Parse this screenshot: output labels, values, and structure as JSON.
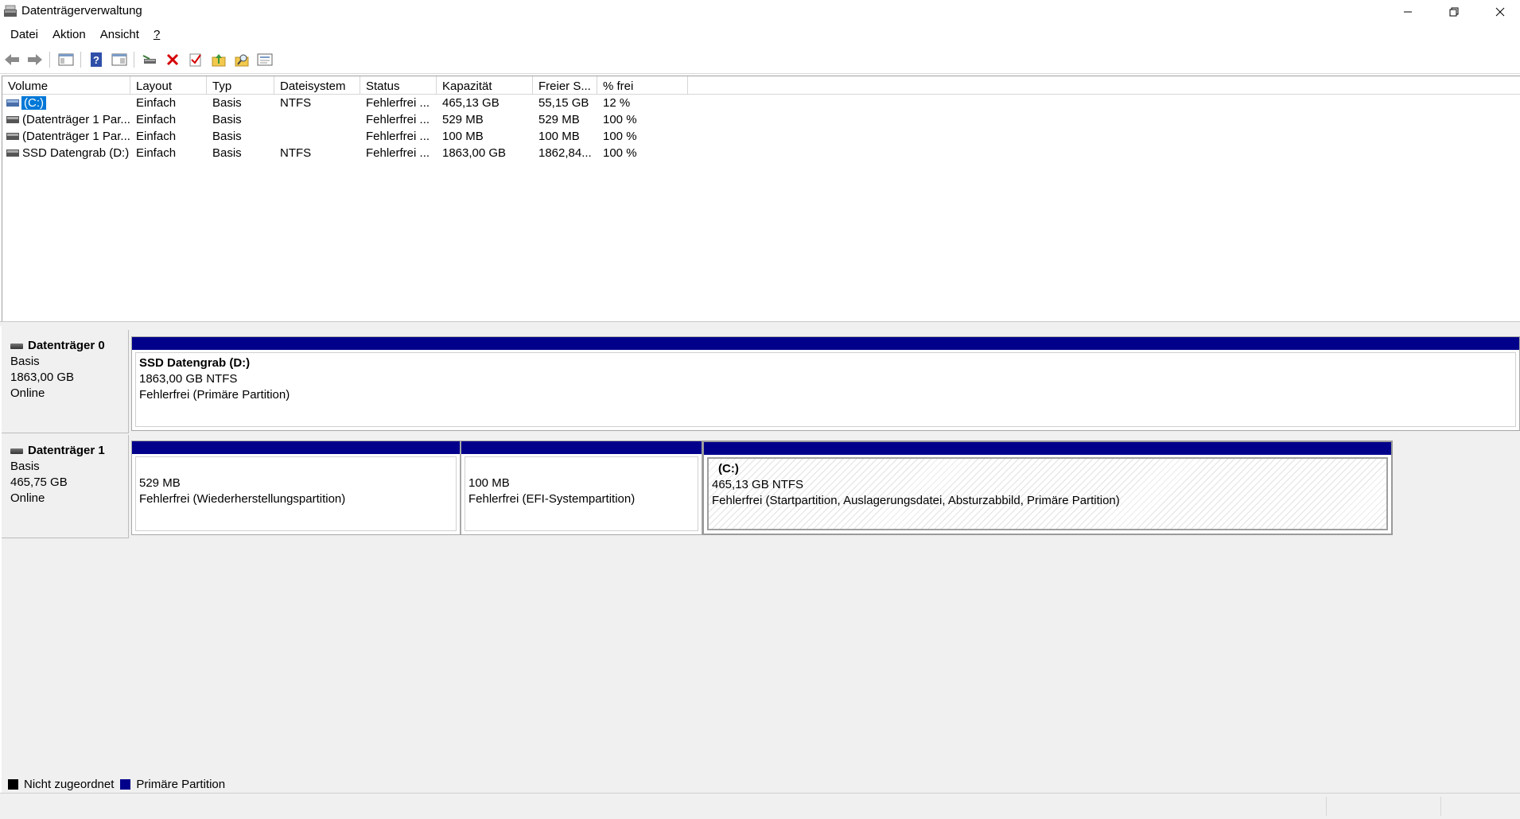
{
  "window": {
    "title": "Datenträgerverwaltung"
  },
  "menu": [
    "Datei",
    "Aktion",
    "Ansicht",
    "?"
  ],
  "toolbar": {
    "icons": [
      "back-icon",
      "forward-icon",
      "console-tree-icon",
      "help-icon",
      "properties-icon",
      "connect-icon",
      "delete-icon",
      "check-icon",
      "up-folder-icon",
      "search-folder-icon",
      "settings-list-icon"
    ],
    "accent_delete": "#d40000"
  },
  "columns": [
    "Volume",
    "Layout",
    "Typ",
    "Dateisystem",
    "Status",
    "Kapazität",
    "Freier S...",
    "% frei"
  ],
  "volumes": [
    {
      "volume": "(C:)",
      "layout": "Einfach",
      "type": "Basis",
      "fs": "NTFS",
      "status": "Fehlerfrei ...",
      "capacity": "465,13 GB",
      "free": "55,15 GB",
      "pct": "12 %"
    },
    {
      "volume": "(Datenträger 1 Par...",
      "layout": "Einfach",
      "type": "Basis",
      "fs": "",
      "status": "Fehlerfrei ...",
      "capacity": "529 MB",
      "free": "529 MB",
      "pct": "100 %"
    },
    {
      "volume": "(Datenträger 1 Par...",
      "layout": "Einfach",
      "type": "Basis",
      "fs": "",
      "status": "Fehlerfrei ...",
      "capacity": "100 MB",
      "free": "100 MB",
      "pct": "100 %"
    },
    {
      "volume": "SSD Datengrab (D:)",
      "layout": "Einfach",
      "type": "Basis",
      "fs": "NTFS",
      "status": "Fehlerfrei ...",
      "capacity": "1863,00 GB",
      "free": "1862,84...",
      "pct": "100 %"
    }
  ],
  "disks": [
    {
      "name": "Datenträger 0",
      "type": "Basis",
      "size": "1863,00 GB",
      "state": "Online",
      "partitions": [
        {
          "title": "SSD Datengrab  (D:)",
          "size": "1863,00 GB NTFS",
          "status": "Fehlerfrei (Primäre Partition)"
        }
      ]
    },
    {
      "name": "Datenträger 1",
      "type": "Basis",
      "size": "465,75 GB",
      "state": "Online",
      "partitions": [
        {
          "title": "",
          "size": "529 MB",
          "status": "Fehlerfrei (Wiederherstellungspartition)"
        },
        {
          "title": "",
          "size": "100 MB",
          "status": "Fehlerfrei (EFI-Systempartition)"
        },
        {
          "title": "(C:)",
          "size": "465,13 GB NTFS",
          "status": "Fehlerfrei (Startpartition, Auslagerungsdatei, Absturzabbild, Primäre Partition)"
        }
      ]
    }
  ],
  "legend": [
    {
      "label": "Nicht zugeordnet",
      "color": "#000000"
    },
    {
      "label": "Primäre Partition",
      "color": "#00008b"
    }
  ],
  "colors": {
    "partition_bar": "#00008b",
    "selection": "#0078d7"
  }
}
